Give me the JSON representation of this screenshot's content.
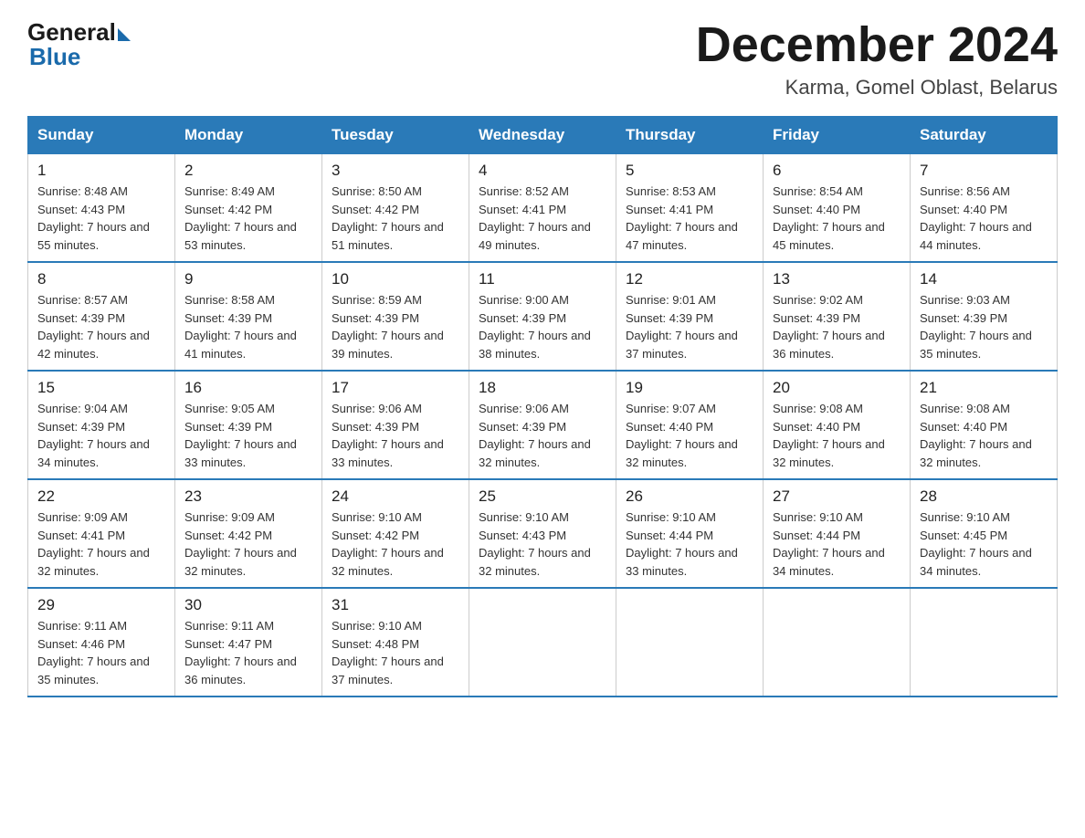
{
  "header": {
    "logo_general": "General",
    "logo_blue": "Blue",
    "month_title": "December 2024",
    "location": "Karma, Gomel Oblast, Belarus"
  },
  "weekdays": [
    "Sunday",
    "Monday",
    "Tuesday",
    "Wednesday",
    "Thursday",
    "Friday",
    "Saturday"
  ],
  "weeks": [
    [
      {
        "day": "1",
        "sunrise": "8:48 AM",
        "sunset": "4:43 PM",
        "daylight": "7 hours and 55 minutes."
      },
      {
        "day": "2",
        "sunrise": "8:49 AM",
        "sunset": "4:42 PM",
        "daylight": "7 hours and 53 minutes."
      },
      {
        "day": "3",
        "sunrise": "8:50 AM",
        "sunset": "4:42 PM",
        "daylight": "7 hours and 51 minutes."
      },
      {
        "day": "4",
        "sunrise": "8:52 AM",
        "sunset": "4:41 PM",
        "daylight": "7 hours and 49 minutes."
      },
      {
        "day": "5",
        "sunrise": "8:53 AM",
        "sunset": "4:41 PM",
        "daylight": "7 hours and 47 minutes."
      },
      {
        "day": "6",
        "sunrise": "8:54 AM",
        "sunset": "4:40 PM",
        "daylight": "7 hours and 45 minutes."
      },
      {
        "day": "7",
        "sunrise": "8:56 AM",
        "sunset": "4:40 PM",
        "daylight": "7 hours and 44 minutes."
      }
    ],
    [
      {
        "day": "8",
        "sunrise": "8:57 AM",
        "sunset": "4:39 PM",
        "daylight": "7 hours and 42 minutes."
      },
      {
        "day": "9",
        "sunrise": "8:58 AM",
        "sunset": "4:39 PM",
        "daylight": "7 hours and 41 minutes."
      },
      {
        "day": "10",
        "sunrise": "8:59 AM",
        "sunset": "4:39 PM",
        "daylight": "7 hours and 39 minutes."
      },
      {
        "day": "11",
        "sunrise": "9:00 AM",
        "sunset": "4:39 PM",
        "daylight": "7 hours and 38 minutes."
      },
      {
        "day": "12",
        "sunrise": "9:01 AM",
        "sunset": "4:39 PM",
        "daylight": "7 hours and 37 minutes."
      },
      {
        "day": "13",
        "sunrise": "9:02 AM",
        "sunset": "4:39 PM",
        "daylight": "7 hours and 36 minutes."
      },
      {
        "day": "14",
        "sunrise": "9:03 AM",
        "sunset": "4:39 PM",
        "daylight": "7 hours and 35 minutes."
      }
    ],
    [
      {
        "day": "15",
        "sunrise": "9:04 AM",
        "sunset": "4:39 PM",
        "daylight": "7 hours and 34 minutes."
      },
      {
        "day": "16",
        "sunrise": "9:05 AM",
        "sunset": "4:39 PM",
        "daylight": "7 hours and 33 minutes."
      },
      {
        "day": "17",
        "sunrise": "9:06 AM",
        "sunset": "4:39 PM",
        "daylight": "7 hours and 33 minutes."
      },
      {
        "day": "18",
        "sunrise": "9:06 AM",
        "sunset": "4:39 PM",
        "daylight": "7 hours and 32 minutes."
      },
      {
        "day": "19",
        "sunrise": "9:07 AM",
        "sunset": "4:40 PM",
        "daylight": "7 hours and 32 minutes."
      },
      {
        "day": "20",
        "sunrise": "9:08 AM",
        "sunset": "4:40 PM",
        "daylight": "7 hours and 32 minutes."
      },
      {
        "day": "21",
        "sunrise": "9:08 AM",
        "sunset": "4:40 PM",
        "daylight": "7 hours and 32 minutes."
      }
    ],
    [
      {
        "day": "22",
        "sunrise": "9:09 AM",
        "sunset": "4:41 PM",
        "daylight": "7 hours and 32 minutes."
      },
      {
        "day": "23",
        "sunrise": "9:09 AM",
        "sunset": "4:42 PM",
        "daylight": "7 hours and 32 minutes."
      },
      {
        "day": "24",
        "sunrise": "9:10 AM",
        "sunset": "4:42 PM",
        "daylight": "7 hours and 32 minutes."
      },
      {
        "day": "25",
        "sunrise": "9:10 AM",
        "sunset": "4:43 PM",
        "daylight": "7 hours and 32 minutes."
      },
      {
        "day": "26",
        "sunrise": "9:10 AM",
        "sunset": "4:44 PM",
        "daylight": "7 hours and 33 minutes."
      },
      {
        "day": "27",
        "sunrise": "9:10 AM",
        "sunset": "4:44 PM",
        "daylight": "7 hours and 34 minutes."
      },
      {
        "day": "28",
        "sunrise": "9:10 AM",
        "sunset": "4:45 PM",
        "daylight": "7 hours and 34 minutes."
      }
    ],
    [
      {
        "day": "29",
        "sunrise": "9:11 AM",
        "sunset": "4:46 PM",
        "daylight": "7 hours and 35 minutes."
      },
      {
        "day": "30",
        "sunrise": "9:11 AM",
        "sunset": "4:47 PM",
        "daylight": "7 hours and 36 minutes."
      },
      {
        "day": "31",
        "sunrise": "9:10 AM",
        "sunset": "4:48 PM",
        "daylight": "7 hours and 37 minutes."
      },
      null,
      null,
      null,
      null
    ]
  ]
}
